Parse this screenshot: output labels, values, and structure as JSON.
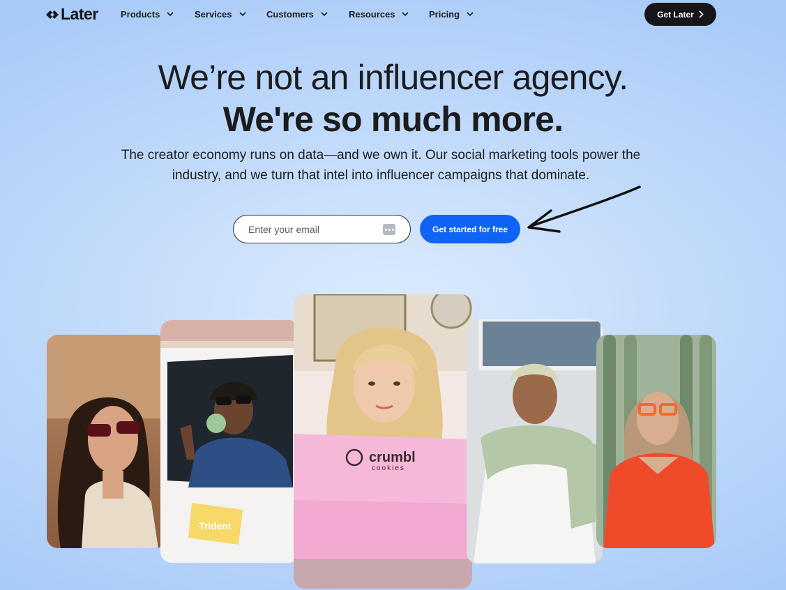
{
  "nav": {
    "logo": "Later",
    "items": [
      {
        "label": "Products"
      },
      {
        "label": "Services"
      },
      {
        "label": "Customers"
      },
      {
        "label": "Resources"
      },
      {
        "label": "Pricing"
      }
    ],
    "cta": "Get Later"
  },
  "hero": {
    "line1": "We’re not an influencer agency.",
    "line2": "We're so much more.",
    "subtitle": "The creator economy runs on data—and we own it. Our social marketing tools power the industry, and we turn that intel into influencer campaigns that dominate.",
    "email_placeholder": "Enter your email",
    "cta": "Get started for free"
  },
  "gallery": {
    "brand_box_text": "crumbl",
    "brand_box_sub": "cookies",
    "gum_label": "Trident"
  }
}
